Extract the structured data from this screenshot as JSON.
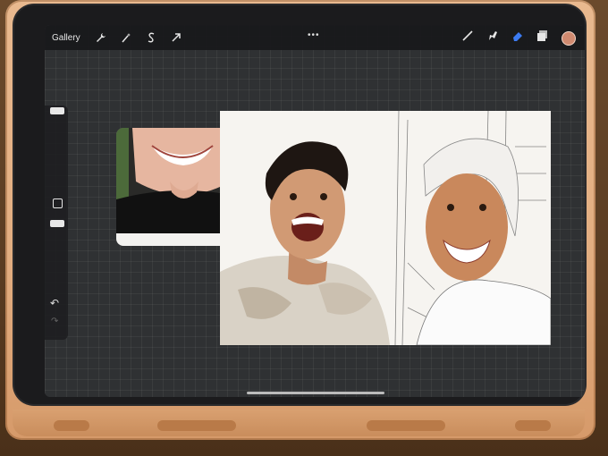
{
  "topbar": {
    "gallery_label": "Gallery",
    "left_tools": [
      "wrench-icon",
      "magic-wand-icon",
      "selection-s-icon",
      "transform-arrow-icon"
    ],
    "right_tools": [
      "brush-icon",
      "smudge-icon",
      "eraser-icon",
      "layers-icon"
    ],
    "more_label": "•••",
    "color": "#d08a70"
  },
  "sidebar": {
    "undo_label": "↶",
    "redo_label": "↷"
  },
  "accent": "#3c7bf2"
}
